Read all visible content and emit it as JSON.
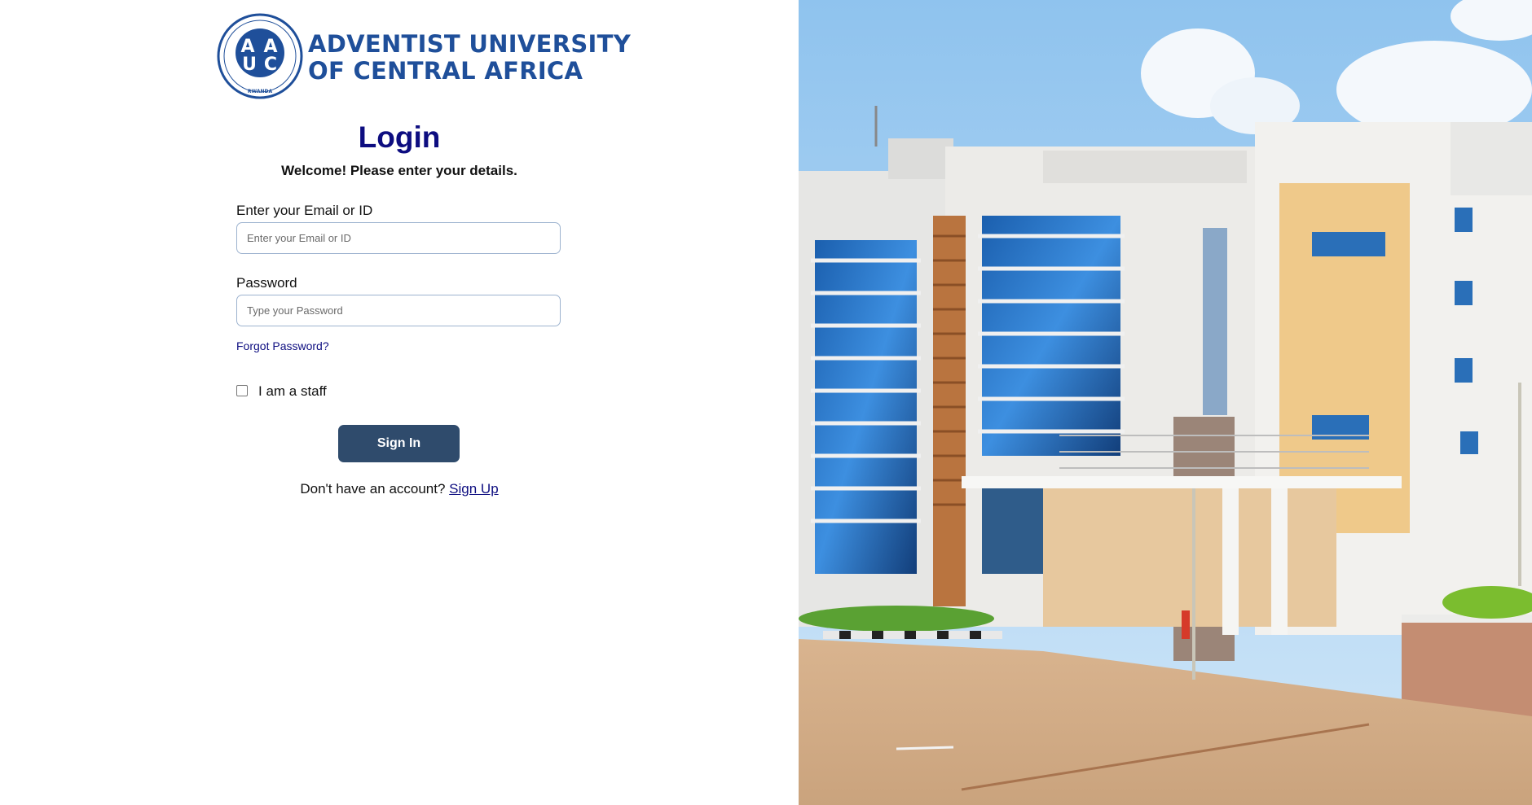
{
  "brand": {
    "logo_line1": "ADVENTIST UNIVERSITY",
    "logo_line2": "OF CENTRAL AFRICA",
    "seal_ring": "ADVENTIST UNIVERSITY OF CENTRAL AFRICA",
    "seal_country": "RWANDA",
    "seal_monogram": "AUCA",
    "color": "#1f4f9a"
  },
  "login": {
    "title": "Login",
    "subtitle": "Welcome! Please enter your details.",
    "email_label": "Enter your Email or ID",
    "email_placeholder": "Enter your Email or ID",
    "email_value": "",
    "password_label": "Password",
    "password_placeholder": "Type your Password",
    "password_value": "",
    "forgot_label": "Forgot Password?",
    "staff_label": "I am a staff",
    "staff_checked": false,
    "signin_label": "Sign In",
    "no_account_text": "Don't have an account?",
    "signup_label": "Sign Up"
  },
  "colors": {
    "title": "#0d0d80",
    "button": "#2f4b6c",
    "link": "#0d0d80",
    "input_border": "#9db3cf"
  }
}
